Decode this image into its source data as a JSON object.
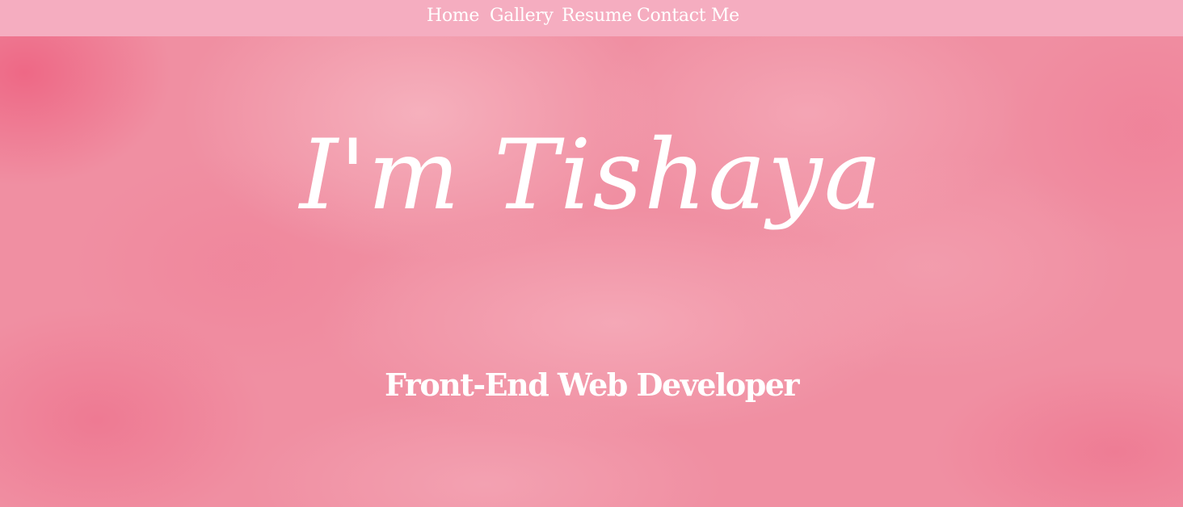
{
  "nav": {
    "items": [
      {
        "label": "Home"
      },
      {
        "label": "Gallery"
      },
      {
        "label": "Resume"
      },
      {
        "label": "Contact Me"
      }
    ]
  },
  "hero": {
    "title": "I'm Tishaya",
    "subtitle": "Front-End Web Developer"
  },
  "colors": {
    "navbar_background": "#f5adc0",
    "hero_background": "#f08fa2",
    "text": "#ffffff"
  }
}
